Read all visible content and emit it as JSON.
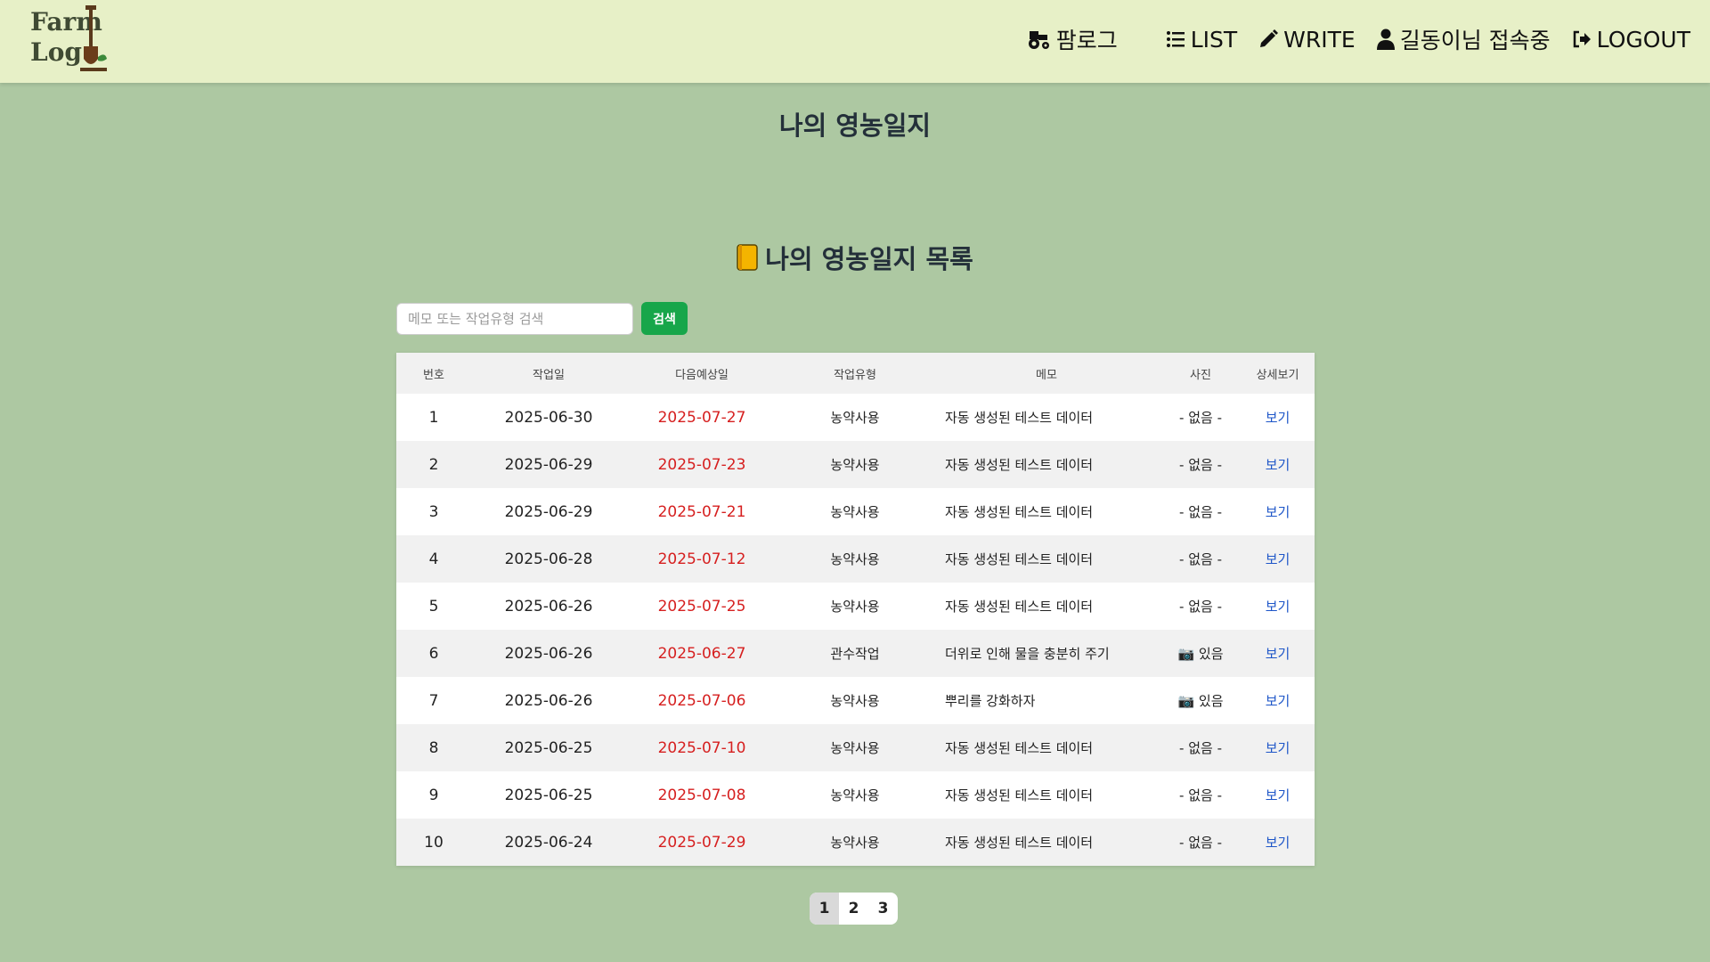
{
  "logo": {
    "line1": "Farm",
    "line2": "Log"
  },
  "nav": {
    "brand": "팜로그",
    "list": "LIST",
    "write": "WRITE",
    "user": "길동이님 접속중",
    "logout": "LOGOUT"
  },
  "page_title": "나의 영농일지",
  "list_title": "나의 영농일지 목록",
  "search": {
    "placeholder": "메모 또는 작업유형 검색",
    "value": "",
    "button": "검색"
  },
  "table": {
    "headers": [
      "번호",
      "작업일",
      "다음예상일",
      "작업유형",
      "메모",
      "사진",
      "상세보기"
    ],
    "rows": [
      {
        "no": "1",
        "date": "2025-06-30",
        "next": "2025-07-27",
        "type": "농약사용",
        "memo": "자동 생성된 테스트 데이터",
        "photo": "- 없음 -",
        "view": "보기"
      },
      {
        "no": "2",
        "date": "2025-06-29",
        "next": "2025-07-23",
        "type": "농약사용",
        "memo": "자동 생성된 테스트 데이터",
        "photo": "- 없음 -",
        "view": "보기"
      },
      {
        "no": "3",
        "date": "2025-06-29",
        "next": "2025-07-21",
        "type": "농약사용",
        "memo": "자동 생성된 테스트 데이터",
        "photo": "- 없음 -",
        "view": "보기"
      },
      {
        "no": "4",
        "date": "2025-06-28",
        "next": "2025-07-12",
        "type": "농약사용",
        "memo": "자동 생성된 테스트 데이터",
        "photo": "- 없음 -",
        "view": "보기"
      },
      {
        "no": "5",
        "date": "2025-06-26",
        "next": "2025-07-25",
        "type": "농약사용",
        "memo": "자동 생성된 테스트 데이터",
        "photo": "- 없음 -",
        "view": "보기"
      },
      {
        "no": "6",
        "date": "2025-06-26",
        "next": "2025-06-27",
        "type": "관수작업",
        "memo": "더위로 인해 물을 충분히 주기",
        "photo": "📷 있음",
        "view": "보기"
      },
      {
        "no": "7",
        "date": "2025-06-26",
        "next": "2025-07-06",
        "type": "농약사용",
        "memo": "뿌리를 강화하자",
        "photo": "📷 있음",
        "view": "보기"
      },
      {
        "no": "8",
        "date": "2025-06-25",
        "next": "2025-07-10",
        "type": "농약사용",
        "memo": "자동 생성된 테스트 데이터",
        "photo": "- 없음 -",
        "view": "보기"
      },
      {
        "no": "9",
        "date": "2025-06-25",
        "next": "2025-07-08",
        "type": "농약사용",
        "memo": "자동 생성된 테스트 데이터",
        "photo": "- 없음 -",
        "view": "보기"
      },
      {
        "no": "10",
        "date": "2025-06-24",
        "next": "2025-07-29",
        "type": "농약사용",
        "memo": "자동 생성된 테스트 데이터",
        "photo": "- 없음 -",
        "view": "보기"
      }
    ]
  },
  "pagination": {
    "pages": [
      "1",
      "2",
      "3"
    ],
    "current": "1"
  },
  "colors": {
    "background": "#adc8a2",
    "header": "#e7f0c7",
    "next_date": "#d62020",
    "link": "#1e56c8",
    "search_button": "#17a64a"
  },
  "icons": {
    "brand": "tractor-icon",
    "list": "list-icon",
    "write": "pencil-icon",
    "user": "user-icon",
    "logout": "logout-icon",
    "list_title": "notebook-icon"
  }
}
